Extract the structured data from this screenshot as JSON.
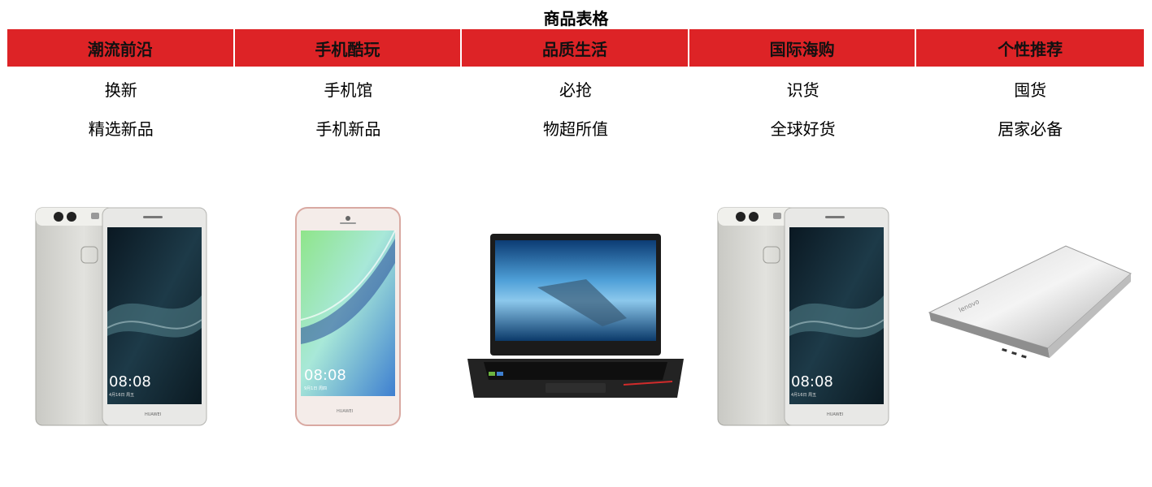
{
  "caption": "商品表格",
  "columns": [
    {
      "header": "潮流前沿",
      "row1": "换新",
      "row2": "精选新品",
      "image": "phone-silver-icon"
    },
    {
      "header": "手机酷玩",
      "row1": "手机馆",
      "row2": "手机新品",
      "image": "phone-pink-icon"
    },
    {
      "header": "品质生活",
      "row1": "必抢",
      "row2": "物超所值",
      "image": "laptop-black-icon"
    },
    {
      "header": "国际海购",
      "row1": "识货",
      "row2": "全球好货",
      "image": "phone-silver-icon"
    },
    {
      "header": "个性推荐",
      "row1": "囤货",
      "row2": "居家必备",
      "image": "laptop-silver-icon"
    }
  ],
  "phone_screen_text": {
    "time": "08:08",
    "date": "4月16日 周五",
    "brand": "HUAWEI"
  },
  "phone2_screen_text": {
    "time": "08:08",
    "date": "9月1日 周四",
    "brand": "HUAWEI"
  },
  "laptop_brand": "lenovo",
  "colors": {
    "header_bg": "#dd2326",
    "text": "#000000",
    "background": "#ffffff"
  }
}
